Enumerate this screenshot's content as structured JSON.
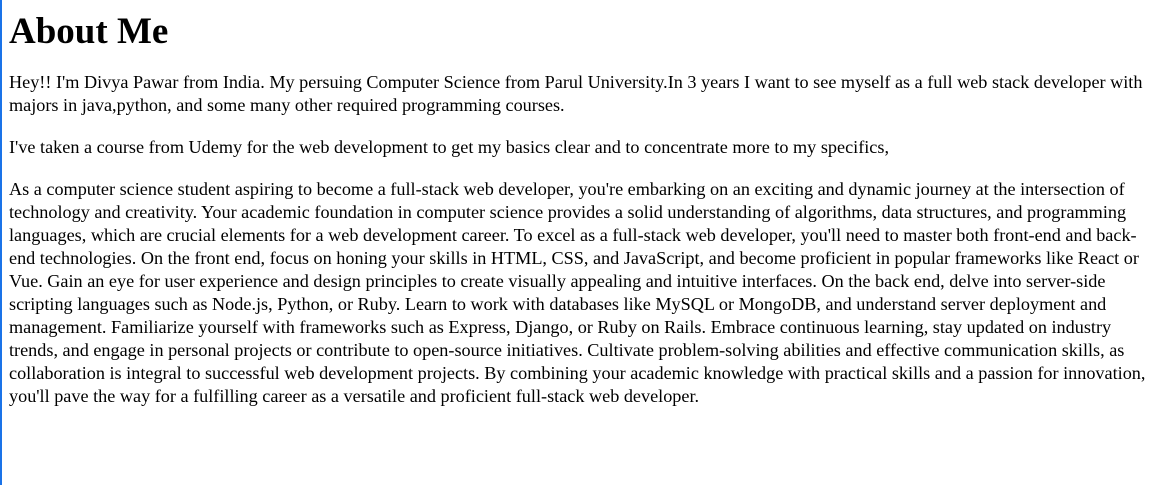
{
  "page": {
    "title": "About Me",
    "paragraphs": [
      "Hey!! I'm Divya Pawar from India. My persuing Computer Science from Parul University.In 3 years I want to see myself as a full web stack developer with majors in java,python, and some many other required programming courses.",
      "I've taken a course from Udemy for the web development to get my basics clear and to concentrate more to my specifics,",
      "As a computer science student aspiring to become a full-stack web developer, you're embarking on an exciting and dynamic journey at the intersection of technology and creativity. Your academic foundation in computer science provides a solid understanding of algorithms, data structures, and programming languages, which are crucial elements for a web development career. To excel as a full-stack web developer, you'll need to master both front-end and back-end technologies. On the front end, focus on honing your skills in HTML, CSS, and JavaScript, and become proficient in popular frameworks like React or Vue. Gain an eye for user experience and design principles to create visually appealing and intuitive interfaces. On the back end, delve into server-side scripting languages such as Node.js, Python, or Ruby. Learn to work with databases like MySQL or MongoDB, and understand server deployment and management. Familiarize yourself with frameworks such as Express, Django, or Ruby on Rails. Embrace continuous learning, stay updated on industry trends, and engage in personal projects or contribute to open-source initiatives. Cultivate problem-solving abilities and effective communication skills, as collaboration is integral to successful web development projects. By combining your academic knowledge with practical skills and a passion for innovation, you'll pave the way for a fulfilling career as a versatile and proficient full-stack web developer."
    ]
  },
  "colors": {
    "text": "#000000",
    "background": "#ffffff",
    "left_edge": "#1a73e8"
  }
}
